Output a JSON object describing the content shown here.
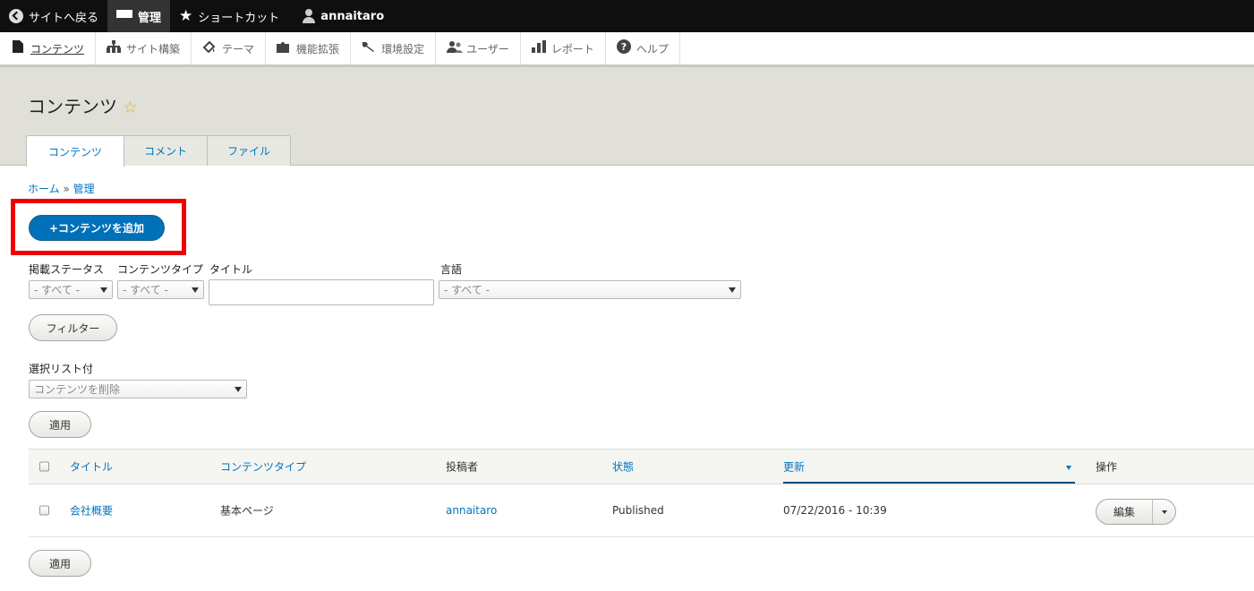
{
  "toolbar": {
    "back": "サイトへ戻る",
    "manage": "管理",
    "shortcuts": "ショートカット",
    "user": "annaitaro"
  },
  "tray": {
    "items": [
      {
        "label": "コンテンツ",
        "icon": "page-icon"
      },
      {
        "label": "サイト構築",
        "icon": "sitemap-icon"
      },
      {
        "label": "テーマ",
        "icon": "paint-icon"
      },
      {
        "label": "機能拡張",
        "icon": "puzzle-icon"
      },
      {
        "label": "環境設定",
        "icon": "wrench-icon"
      },
      {
        "label": "ユーザー",
        "icon": "people-icon"
      },
      {
        "label": "レポート",
        "icon": "bar-chart-icon"
      },
      {
        "label": "ヘルプ",
        "icon": "help-icon"
      }
    ]
  },
  "page": {
    "title": "コンテンツ",
    "favorite_glyph": "☆"
  },
  "tabs": [
    {
      "label": "コンテンツ"
    },
    {
      "label": "コメント"
    },
    {
      "label": "ファイル"
    }
  ],
  "breadcrumb": {
    "home": "ホーム",
    "sep": "»",
    "current": "管理"
  },
  "add_button": "+コンテンツを追加",
  "filters": {
    "status_label": "掲載ステータス",
    "status_value": "- すべて -",
    "type_label": "コンテンツタイプ",
    "type_value": "- すべて -",
    "title_label": "タイトル",
    "title_value": "",
    "lang_label": "言語",
    "lang_value": "- すべて -",
    "filter_button": "フィルター"
  },
  "bulk": {
    "label": "選択リスト付",
    "value": "コンテンツを削除",
    "apply": "適用"
  },
  "table": {
    "headers": {
      "title": "タイトル",
      "type": "コンテンツタイプ",
      "author": "投稿者",
      "status": "状態",
      "updated": "更新",
      "ops": "操作"
    },
    "rows": [
      {
        "title": "会社概要",
        "type": "基本ページ",
        "author": "annaitaro",
        "status": "Published",
        "updated": "07/22/2016 - 10:39",
        "edit": "編集"
      }
    ]
  },
  "bottom_apply": "適用",
  "colors": {
    "highlight": "#ee0000",
    "primary": "#0071b8",
    "link": "#0074bd"
  }
}
